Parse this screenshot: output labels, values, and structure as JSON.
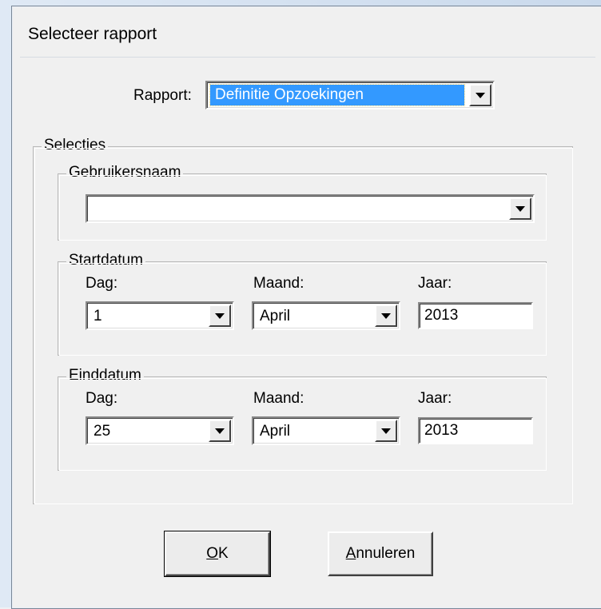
{
  "window": {
    "title": "Selecteer rapport"
  },
  "rapport": {
    "label": "Rapport:",
    "value": "Definitie Opzoekingen"
  },
  "selecties": {
    "legend": "Selecties",
    "gebruikersnaam": {
      "legend": "Gebruikersnaam",
      "value": ""
    },
    "startdatum": {
      "legend": "Startdatum",
      "dag_label": "Dag:",
      "dag_value": "1",
      "maand_label": "Maand:",
      "maand_value": "April",
      "jaar_label": "Jaar:",
      "jaar_value": "2013"
    },
    "einddatum": {
      "legend": "Einddatum",
      "dag_label": "Dag:",
      "dag_value": "25",
      "maand_label": "Maand:",
      "maand_value": "April",
      "jaar_label": "Jaar:",
      "jaar_value": "2013"
    }
  },
  "buttons": {
    "ok": {
      "mnemonic": "O",
      "rest": "K"
    },
    "annuleren": {
      "mnemonic": "A",
      "rest": "nnuleren"
    }
  },
  "icons": {
    "dropdown": "chevron-down-icon"
  }
}
